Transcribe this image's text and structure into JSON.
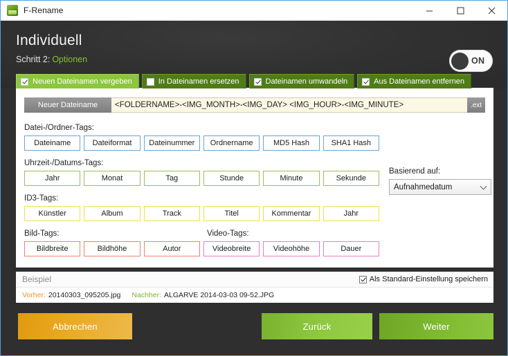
{
  "window": {
    "title": "F-Rename",
    "icon": "app-icon",
    "controls": {
      "minimize": "minimize-icon",
      "maximize": "maximize-icon",
      "close": "close-icon"
    }
  },
  "header": {
    "title": "Individuell",
    "step_label": "Schritt 2:",
    "step_value": "Optionen",
    "toggle_label": "ON",
    "toggle_state": "on"
  },
  "tabs": [
    {
      "label": "Neuen Dateinamen vergeben",
      "checked": true,
      "active": true
    },
    {
      "label": "In Dateinamen ersetzen",
      "checked": false,
      "active": false
    },
    {
      "label": "Dateinamen umwandeln",
      "checked": true,
      "active": false
    },
    {
      "label": "Aus Dateinamen entfernen",
      "checked": true,
      "active": false
    }
  ],
  "filename": {
    "label": "Neuer Dateiname",
    "value": "<FOLDERNAME>-<IMG_MONTH>-<IMG_DAY> <IMG_HOUR>-<IMG_MINUTE>",
    "extension": ".ext"
  },
  "tag_groups": [
    {
      "label": "Datei-/Ordner-Tags:",
      "kind": "file",
      "buttons": [
        "Dateiname",
        "Dateiformat",
        "Dateinummer",
        "Ordnername",
        "MD5 Hash",
        "SHA1 Hash"
      ]
    },
    {
      "label": "Uhrzeit-/Datums-Tags:",
      "kind": "date",
      "buttons": [
        "Jahr",
        "Monat",
        "Tag",
        "Stunde",
        "Minute",
        "Sekunde"
      ]
    },
    {
      "label": "ID3-Tags:",
      "kind": "id3",
      "buttons": [
        "Künstler",
        "Album",
        "Track",
        "Titel",
        "Kommentar",
        "Jahr"
      ]
    }
  ],
  "media_row": {
    "image_label": "Bild-Tags:",
    "video_label": "Video-Tags:",
    "image_buttons": [
      "Bildbreite",
      "Bildhöhe",
      "Autor"
    ],
    "video_buttons": [
      "Videobreite",
      "Videohöhe",
      "Dauer"
    ]
  },
  "based_on": {
    "label": "Basierend auf:",
    "selected": "Aufnahmedatum",
    "chevron": "chevron-down-icon"
  },
  "example": {
    "title": "Beispiel",
    "save_default_label": "Als Standard-Einstellung speichern",
    "save_default_checked": true,
    "before_label": "Vorher:",
    "before_value": "20140303_095205.jpg",
    "after_label": "Nachher:",
    "after_value": "ALGARVE 2014-03-03 09-52.JPG"
  },
  "footer": {
    "cancel": "Abbrechen",
    "back": "Zurück",
    "next": "Weiter"
  },
  "colors": {
    "accent_green": "#8cc63e",
    "tab_inactive": "#4f7c17",
    "orange": "#e9a81e",
    "before_orange": "#e8952a",
    "after_green": "#7ab12f",
    "panel_bg": "#ffffff",
    "window_bg": "#2f2f2f",
    "input_bg": "#fcf8e3"
  }
}
